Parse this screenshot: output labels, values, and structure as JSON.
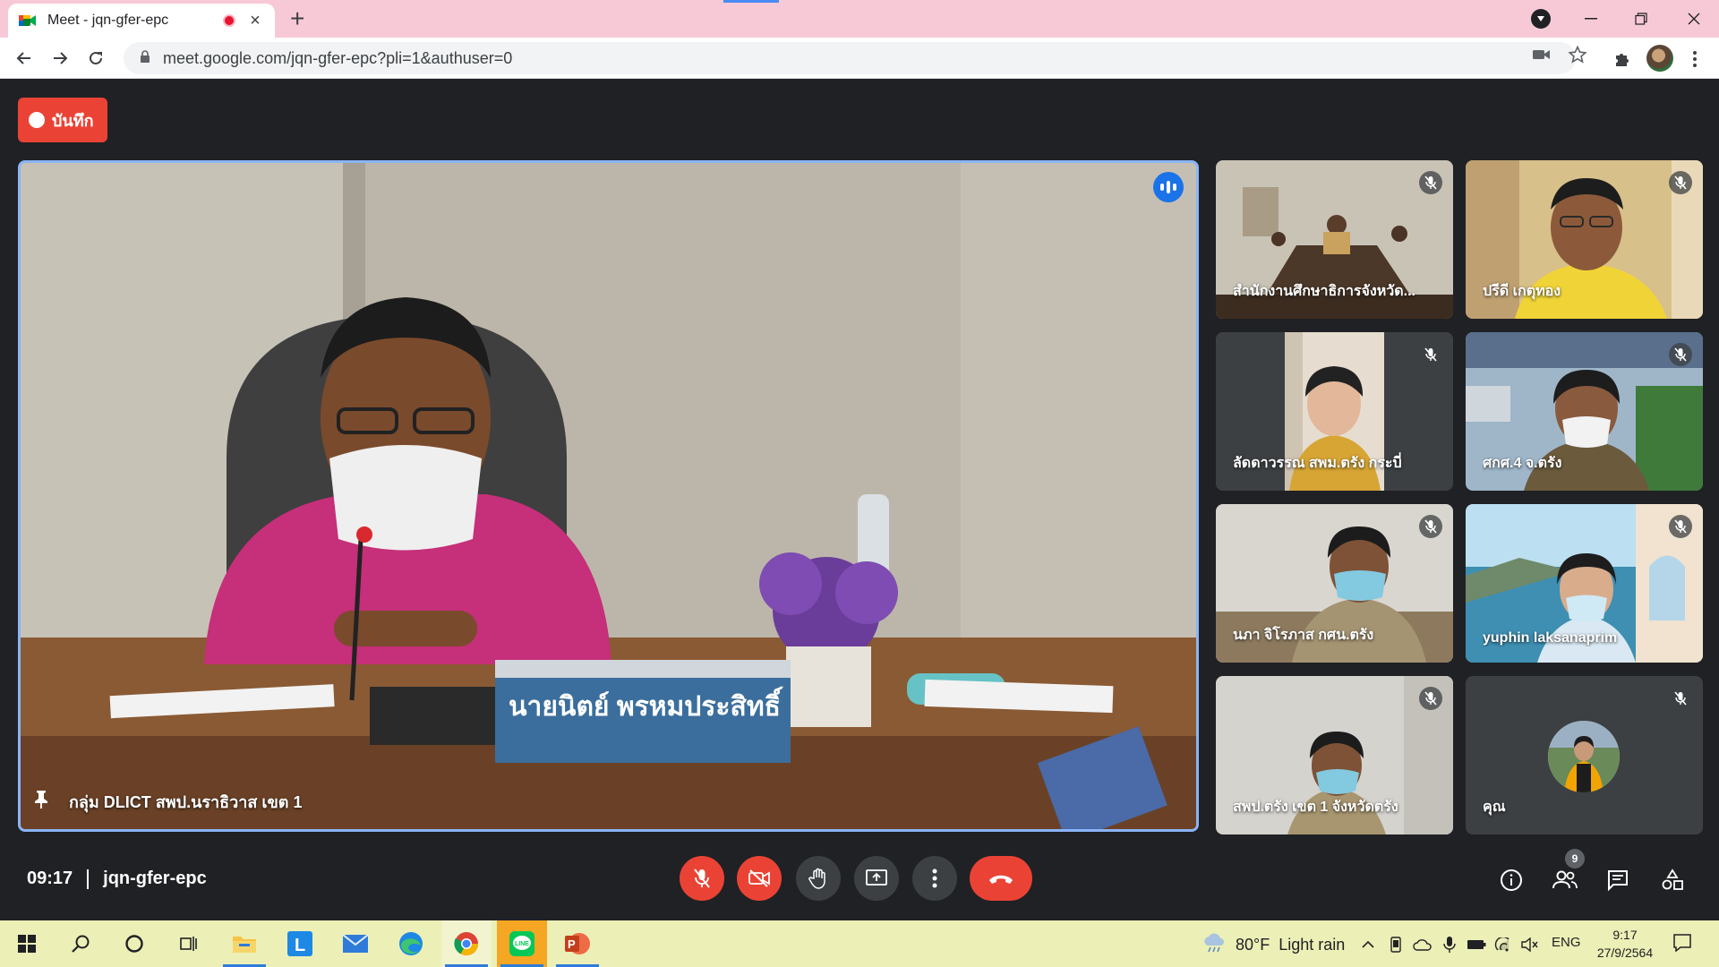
{
  "browser": {
    "tab_title": "Meet - jqn-gfer-epc",
    "url": "meet.google.com/jqn-gfer-epc?pli=1&authuser=0"
  },
  "meet": {
    "recording_label": "บันทึก",
    "main_participant": {
      "name": "กลุ่ม DLICT สพป.นราธิวาส เขต 1",
      "nameplate": "นายนิตย์  พรหมประสิทธิ์"
    },
    "participants": [
      {
        "name": "สำนักงานศึกษาธิการจังหวัด..."
      },
      {
        "name": "ปรีดี เกตุทอง"
      },
      {
        "name": "ลัดดาวรรณ สพม.ตรัง กระบี่"
      },
      {
        "name": "ศกศ.4 จ.ตรัง"
      },
      {
        "name": "นภา จิโรภาส กศน.ตรัง"
      },
      {
        "name": "yuphin laksanaprim"
      },
      {
        "name": "สพป.ตรัง เขต 1 จังหวัดตรัง"
      },
      {
        "name": "คุณ"
      }
    ],
    "time": "09:17",
    "meeting_code": "jqn-gfer-epc",
    "people_count": "9"
  },
  "taskbar": {
    "weather": "80°F  Light rain",
    "language": "ENG",
    "time": "9:17",
    "date": "27/9/2564"
  },
  "colors": {
    "meet_bg": "#202124",
    "accent_red": "#ea4335",
    "speaking_blue": "#1a73e8",
    "active_border": "#8ab4f8",
    "tabstrip": "#f7c9d6",
    "taskbar": "#ecefb6"
  }
}
